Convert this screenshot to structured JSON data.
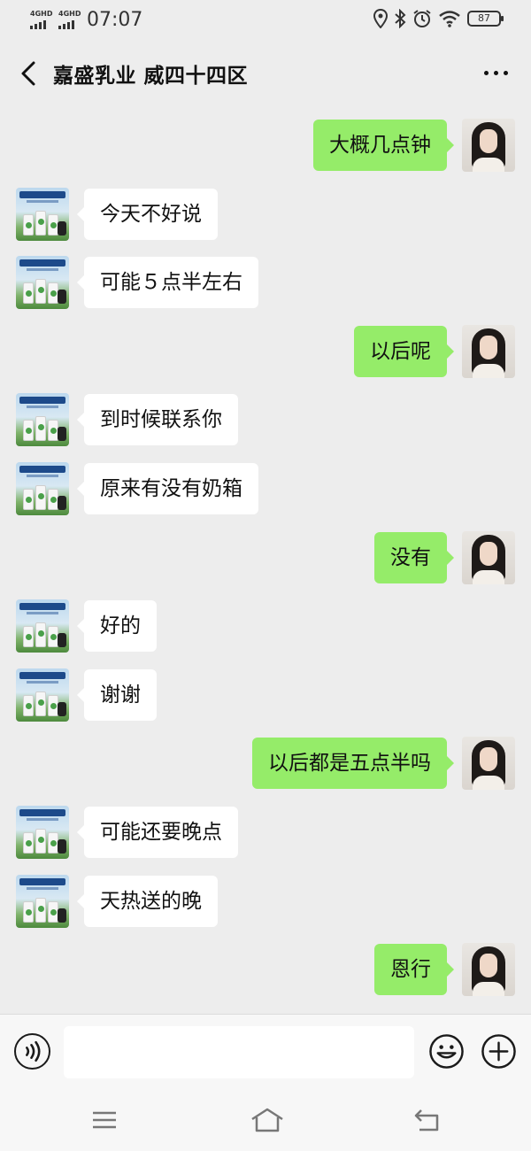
{
  "status_bar": {
    "signal_1": "4GHD",
    "signal_2": "4GHD",
    "time": "07:07",
    "battery": "87"
  },
  "header": {
    "title": "嘉盛乳业 威四十四区",
    "more_icon": "more-dots-icon",
    "back_icon": "chevron-left-icon"
  },
  "colors": {
    "background": "#ededed",
    "sent_bubble": "#95ec69",
    "received_bubble": "#ffffff"
  },
  "messages": [
    {
      "from": "me",
      "text": "大概几点钟"
    },
    {
      "from": "contact",
      "text": "今天不好说"
    },
    {
      "from": "contact",
      "text": "可能５点半左右"
    },
    {
      "from": "me",
      "text": "以后呢"
    },
    {
      "from": "contact",
      "text": "到时候联系你"
    },
    {
      "from": "contact",
      "text": "原来有没有奶箱"
    },
    {
      "from": "me",
      "text": "没有"
    },
    {
      "from": "contact",
      "text": "好的"
    },
    {
      "from": "contact",
      "text": "谢谢"
    },
    {
      "from": "me",
      "text": "以后都是五点半吗"
    },
    {
      "from": "contact",
      "text": "可能还要晚点"
    },
    {
      "from": "contact",
      "text": "天热送的晚"
    },
    {
      "from": "me",
      "text": "恩行"
    }
  ],
  "input_bar": {
    "placeholder": "",
    "voice_icon": "voice-icon",
    "emoji_icon": "emoji-icon",
    "plus_icon": "plus-icon"
  },
  "nav_bar": {
    "icons": [
      "menu-icon",
      "home-icon",
      "back-icon"
    ]
  }
}
